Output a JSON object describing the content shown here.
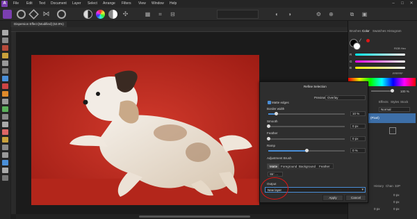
{
  "menu": {
    "items": [
      "File",
      "Edit",
      "Text",
      "Document",
      "Layer",
      "Select",
      "Arrange",
      "Filters",
      "View",
      "Window",
      "Help"
    ]
  },
  "document": {
    "tab_title": "Dispersion Effect [Modified] (53.9%)"
  },
  "right_panel": {
    "tabs": [
      "Brushes",
      "Color",
      "Swatches",
      "Histogram"
    ],
    "active_tab": "Color",
    "color_model": "RGB Hex",
    "channels": [
      "R",
      "G",
      "B"
    ],
    "hex_value": "FFFFFF",
    "opacity": "100 %",
    "layers_tabs": [
      "Effects",
      "Styles",
      "Stock"
    ],
    "blend_mode": "Normal",
    "layer_name": "(Pixel)",
    "history_tabs": [
      "History",
      "Chan",
      "32P"
    ],
    "status_readouts": [
      "0 px",
      "0 px",
      "0 px",
      "0 px"
    ]
  },
  "dialog": {
    "title": "Refine Selection",
    "preview_label": "Preview",
    "preview_value": "Overlay",
    "matte_edges_label": "Matte edges",
    "matte_edges_checked": true,
    "border_width_label": "Border width",
    "border_width_value": "10 %",
    "border_width_level": 0.1,
    "smooth_label": "Smooth",
    "smooth_value": "0 px",
    "smooth_level": 0.0,
    "feather_label": "Feather",
    "feather_value": "0 px",
    "feather_level": 0.0,
    "ramp_label": "Ramp",
    "ramp_value": "0 %",
    "ramp_level": 0.5,
    "brush_label": "Adjustment Brush",
    "brush_modes": [
      "Matte",
      "Foreground",
      "Background",
      "Feather"
    ],
    "active_brush_mode": "Matte",
    "strength_value": "Str: ...",
    "output_label": "Output",
    "output_value": "New layer",
    "apply_label": "Apply",
    "cancel_label": "Cancel"
  },
  "colors": {
    "accent": "#4a8fd8",
    "photo_red": "#c0281c",
    "annotation_red": "#e01515"
  }
}
